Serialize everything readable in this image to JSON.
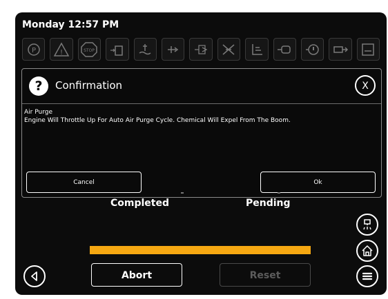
{
  "status": {
    "datetime": "Monday 12:57 PM"
  },
  "warning_icons": [
    "park-brake-icon",
    "warning-triangle-icon",
    "stop-icon",
    "fluid-level-icon",
    "coolant-temperature-icon",
    "hydraulic-pressure-icon",
    "transmission-icon",
    "filter-restriction-icon",
    "hydraulic-oil-icon",
    "engine-icon",
    "oil-pressure-icon",
    "fuel-icon",
    "tank-level-icon"
  ],
  "dialog": {
    "title": "Confirmation",
    "close_label": "X",
    "message_title": "Air Purge",
    "message_body": "Engine Will Throttle Up For Auto Air Purge Cycle.  Chemical Will Expel From The Boom.",
    "cancel_label": "Cancel",
    "ok_label": "Ok"
  },
  "states": {
    "left": "Completed",
    "right": "Pending"
  },
  "progress": {
    "fraction": 1.0,
    "color": "#f6a812"
  },
  "buttons": {
    "abort": "Abort",
    "reset": "Reset"
  },
  "side_buttons": [
    "spray-nozzle-icon",
    "home-icon",
    "menu-icon"
  ],
  "colors": {
    "background": "#0c0c0c",
    "accent": "#f6a812",
    "text": "#ffffff",
    "disabled": "#5c5c5c"
  }
}
